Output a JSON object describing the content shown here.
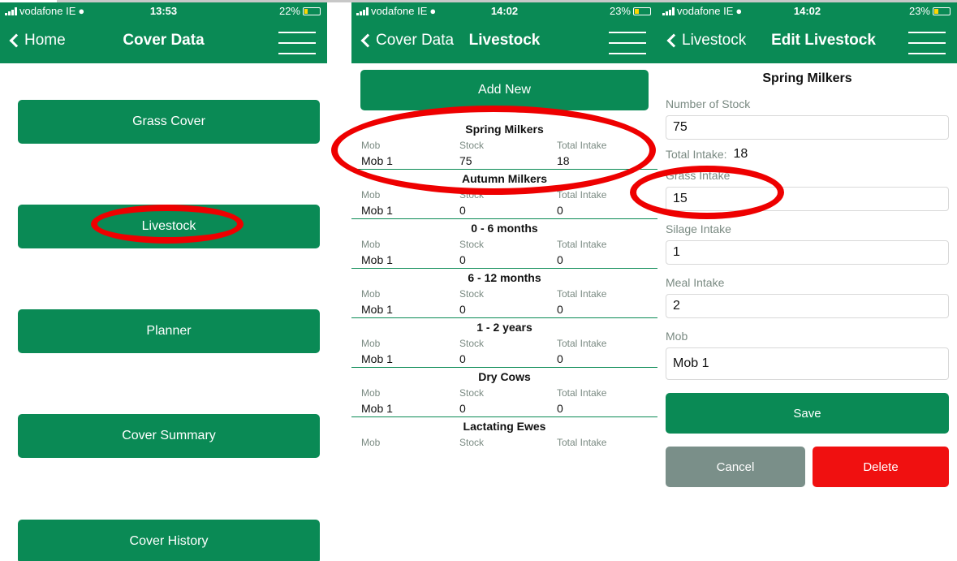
{
  "screen1": {
    "status": {
      "carrier": "vodafone IE",
      "time": "13:53",
      "battery": "22%"
    },
    "back_label": "Home",
    "title": "Cover Data",
    "buttons": [
      "Grass Cover",
      "Livestock",
      "Planner",
      "Cover Summary",
      "Cover History"
    ]
  },
  "screen2": {
    "status": {
      "carrier": "vodafone IE",
      "time": "14:02",
      "battery": "23%"
    },
    "back_label": "Cover Data",
    "title": "Livestock",
    "add_new_label": "Add New",
    "columns": {
      "mob": "Mob",
      "stock": "Stock",
      "total": "Total Intake"
    },
    "groups": [
      {
        "name": "Spring Milkers",
        "mob": "Mob 1",
        "stock": "75",
        "total": "18"
      },
      {
        "name": "Autumn Milkers",
        "mob": "Mob 1",
        "stock": "0",
        "total": "0"
      },
      {
        "name": "0 - 6 months",
        "mob": "Mob 1",
        "stock": "0",
        "total": "0"
      },
      {
        "name": "6 - 12 months",
        "mob": "Mob 1",
        "stock": "0",
        "total": "0"
      },
      {
        "name": "1 - 2 years",
        "mob": "Mob 1",
        "stock": "0",
        "total": "0"
      },
      {
        "name": "Dry Cows",
        "mob": "Mob 1",
        "stock": "0",
        "total": "0"
      },
      {
        "name": "Lactating Ewes",
        "mob": "",
        "stock": "",
        "total": ""
      }
    ]
  },
  "screen3": {
    "status": {
      "carrier": "vodafone IE",
      "time": "14:02",
      "battery": "23%"
    },
    "back_label": "Livestock",
    "title": "Edit Livestock",
    "section_title": "Spring Milkers",
    "number_of_stock": {
      "label": "Number of Stock",
      "value": "75"
    },
    "total_intake": {
      "label": "Total Intake:",
      "value": "18"
    },
    "grass_intake": {
      "label": "Grass Intake",
      "value": "15"
    },
    "silage_intake": {
      "label": "Silage Intake",
      "value": "1"
    },
    "meal_intake": {
      "label": "Meal Intake",
      "value": "2"
    },
    "mob": {
      "label": "Mob",
      "value": "Mob 1"
    },
    "save_label": "Save",
    "cancel_label": "Cancel",
    "delete_label": "Delete"
  },
  "colors": {
    "brand_green": "#0a8a55",
    "delete_red": "#f01010",
    "cancel_grey": "#7a8f89",
    "annotation_red": "#e00000"
  }
}
